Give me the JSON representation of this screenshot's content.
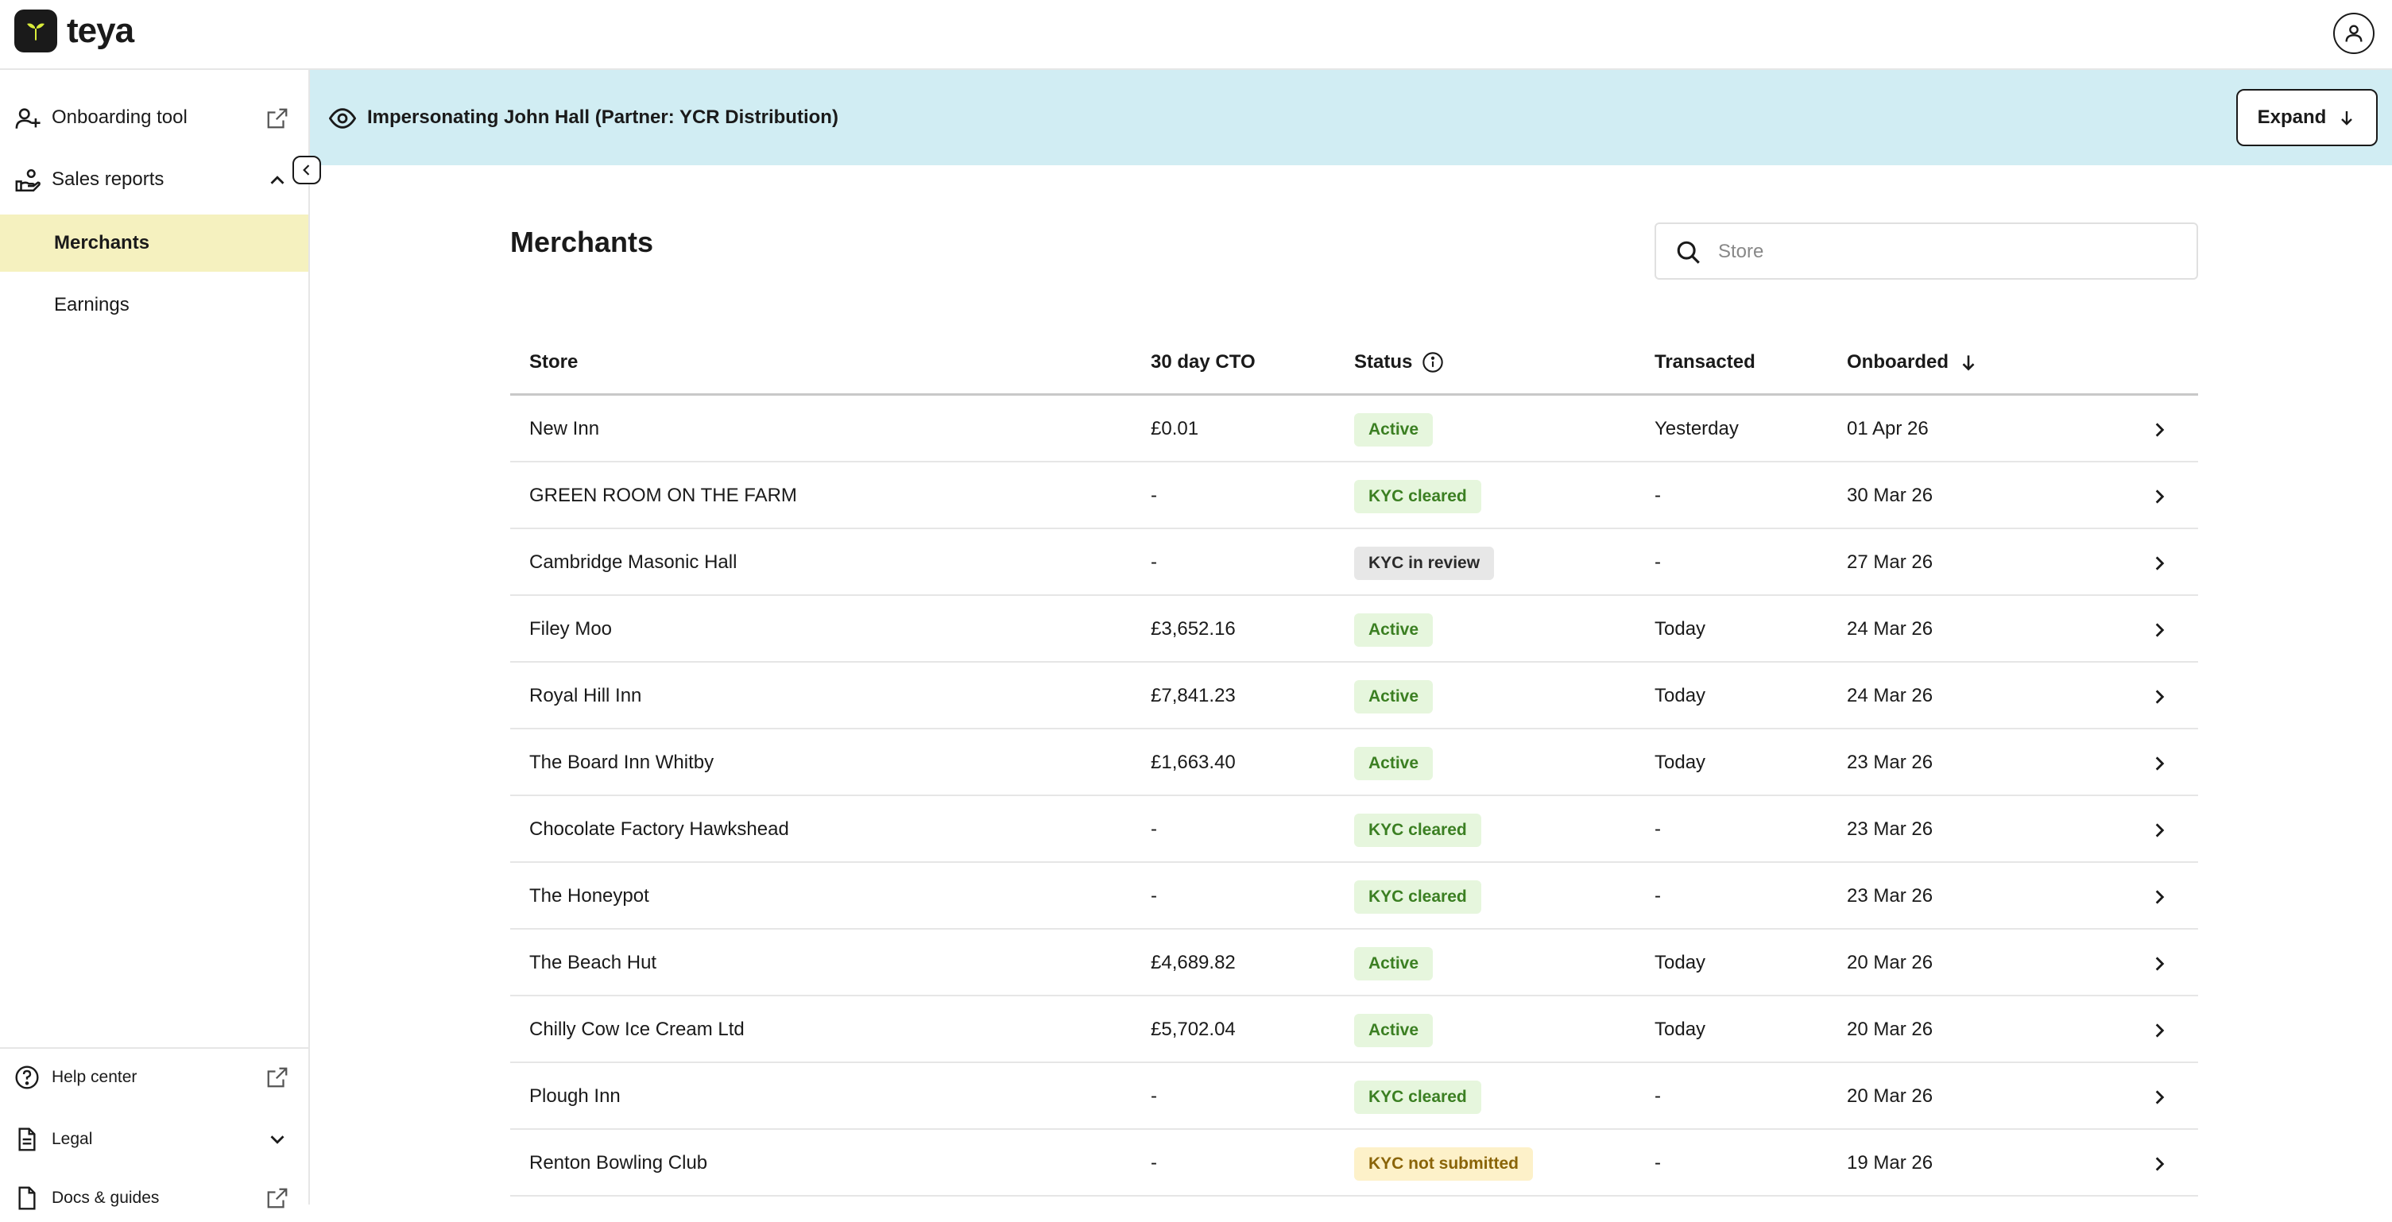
{
  "app": {
    "brand": "teya"
  },
  "sidebar": {
    "items": [
      {
        "label": "Onboarding tool"
      },
      {
        "label": "Sales reports"
      }
    ],
    "sub_items": [
      {
        "label": "Merchants",
        "active": true
      },
      {
        "label": "Earnings",
        "active": false
      }
    ],
    "bottom_items": [
      {
        "label": "Help center"
      },
      {
        "label": "Legal"
      },
      {
        "label": "Docs & guides"
      }
    ]
  },
  "banner": {
    "text": "Impersonating John Hall (Partner: YCR Distribution)",
    "expand_label": "Expand"
  },
  "main": {
    "title": "Merchants",
    "search": {
      "placeholder": "Store",
      "value": ""
    },
    "columns": [
      "Store",
      "30 day CTO",
      "Status",
      "Transacted",
      "Onboarded"
    ],
    "sort": {
      "column": "Onboarded",
      "direction": "descending"
    },
    "rows": [
      {
        "store": "New Inn",
        "cto": "£0.01",
        "status": "Active",
        "status_kind": "green",
        "transacted": "Yesterday",
        "onboarded": "01 Apr 26"
      },
      {
        "store": "GREEN ROOM ON THE FARM",
        "cto": "-",
        "status": "KYC cleared",
        "status_kind": "green",
        "transacted": "-",
        "onboarded": "30 Mar 26"
      },
      {
        "store": "Cambridge Masonic Hall",
        "cto": "-",
        "status": "KYC in review",
        "status_kind": "grey",
        "transacted": "-",
        "onboarded": "27 Mar 26"
      },
      {
        "store": "Filey Moo",
        "cto": "£3,652.16",
        "status": "Active",
        "status_kind": "green",
        "transacted": "Today",
        "onboarded": "24 Mar 26"
      },
      {
        "store": "Royal Hill Inn",
        "cto": "£7,841.23",
        "status": "Active",
        "status_kind": "green",
        "transacted": "Today",
        "onboarded": "24 Mar 26"
      },
      {
        "store": "The Board Inn Whitby",
        "cto": "£1,663.40",
        "status": "Active",
        "status_kind": "green",
        "transacted": "Today",
        "onboarded": "23 Mar 26"
      },
      {
        "store": "Chocolate Factory Hawkshead",
        "cto": "-",
        "status": "KYC cleared",
        "status_kind": "green",
        "transacted": "-",
        "onboarded": "23 Mar 26"
      },
      {
        "store": "The Honeypot",
        "cto": "-",
        "status": "KYC cleared",
        "status_kind": "green",
        "transacted": "-",
        "onboarded": "23 Mar 26"
      },
      {
        "store": "The Beach Hut",
        "cto": "£4,689.82",
        "status": "Active",
        "status_kind": "green",
        "transacted": "Today",
        "onboarded": "20 Mar 26"
      },
      {
        "store": "Chilly Cow Ice Cream Ltd",
        "cto": "£5,702.04",
        "status": "Active",
        "status_kind": "green",
        "transacted": "Today",
        "onboarded": "20 Mar 26"
      },
      {
        "store": "Plough Inn",
        "cto": "-",
        "status": "KYC cleared",
        "status_kind": "green",
        "transacted": "-",
        "onboarded": "20 Mar 26"
      },
      {
        "store": "Renton Bowling Club",
        "cto": "-",
        "status": "KYC not submitted",
        "status_kind": "yellow",
        "transacted": "-",
        "onboarded": "19 Mar 26"
      }
    ]
  },
  "colors": {
    "active_nav_bg": "#f5f1bf",
    "banner_bg": "#d1edf3",
    "badge_green_bg": "#e6f6dd",
    "badge_green_text": "#3b7f22",
    "badge_grey_bg": "#e7e7e7",
    "badge_yellow_bg": "#fdf1c9",
    "badge_yellow_text": "#8a6408"
  },
  "icons": [
    "teya-logo-icon",
    "account-icon",
    "add-user-icon",
    "external-link-icon",
    "sales-icon",
    "chevron-up-icon",
    "chevron-left-icon",
    "help-icon",
    "document-icon",
    "chevron-down-icon",
    "eye-icon",
    "arrow-down-icon",
    "search-icon",
    "info-icon",
    "chevron-right-icon"
  ]
}
